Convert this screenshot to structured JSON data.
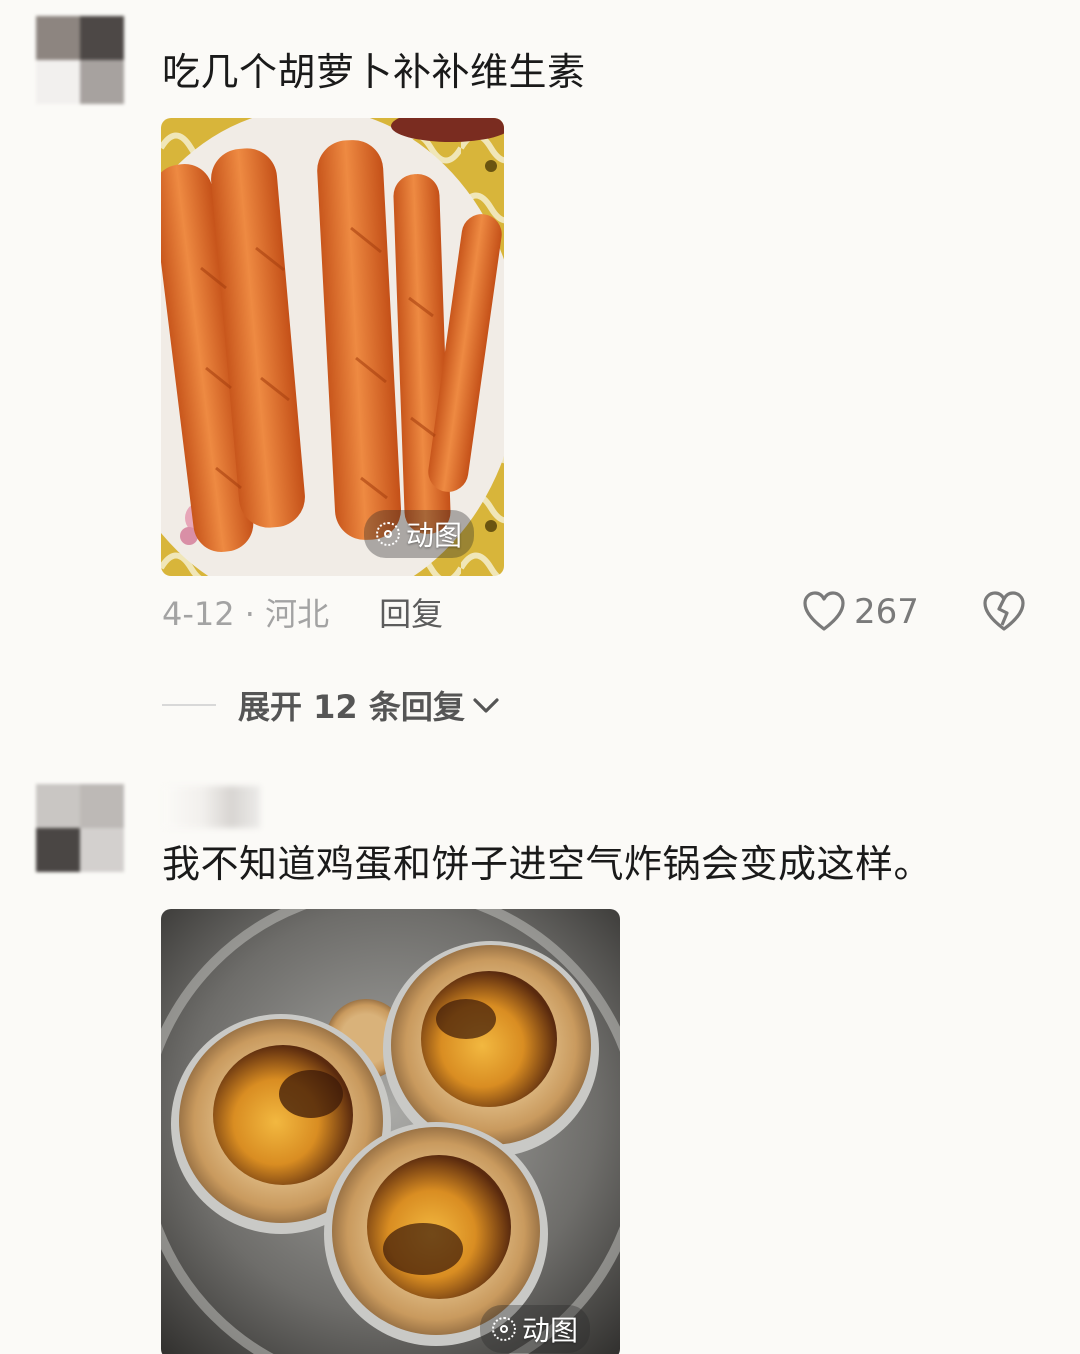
{
  "comments": [
    {
      "text": "吃几个胡萝卜补补维生素",
      "media_badge": "动图",
      "time_location": "4-12 · 河北",
      "reply_label": "回复",
      "likes": "267",
      "expand_replies": "展开 12 条回复"
    },
    {
      "text": "我不知道鸡蛋和饼子进空气炸锅会变成这样。",
      "media_badge": "动图"
    }
  ],
  "icons": {
    "like": "heart-outline-icon",
    "dislike": "broken-heart-icon",
    "expand": "chevron-down-icon",
    "gif": "live-photo-icon"
  },
  "colors": {
    "background": "#fbfaf7",
    "text_primary": "#1a1a1a",
    "text_meta": "#a3a3a3",
    "text_secondary": "#555555"
  }
}
